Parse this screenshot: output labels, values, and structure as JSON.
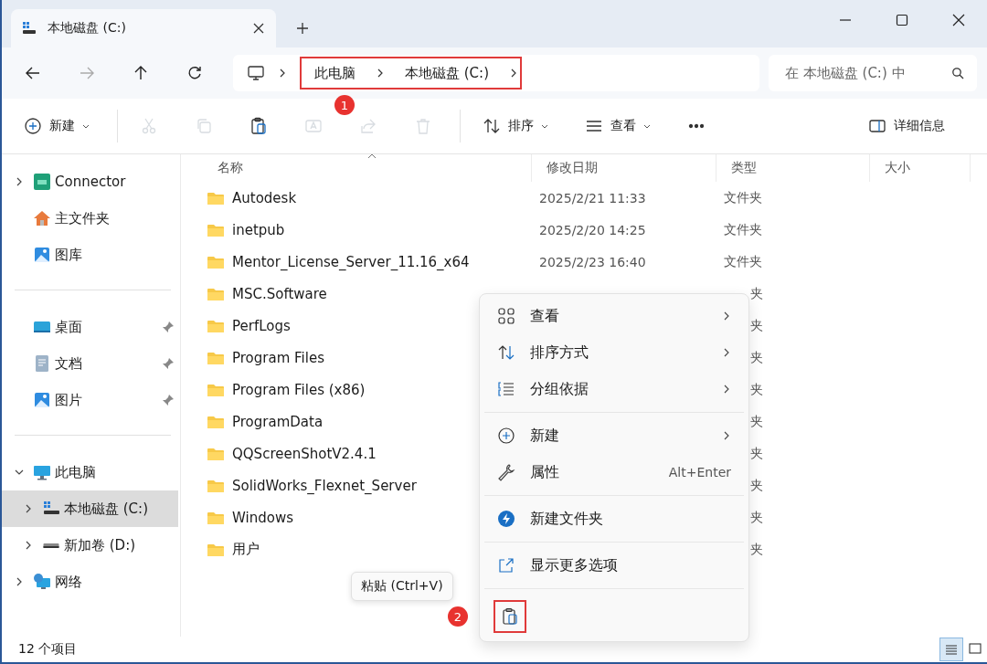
{
  "tab": {
    "title": "本地磁盘 (C:)"
  },
  "breadcrumb": [
    "此电脑",
    "本地磁盘 (C:)"
  ],
  "search": {
    "placeholder": "在 本地磁盘 (C:) 中"
  },
  "toolbar": [
    {
      "kind": "new",
      "label": "新建",
      "disabled": false
    },
    {
      "kind": "cut",
      "disabled": true
    },
    {
      "kind": "copy",
      "disabled": true
    },
    {
      "kind": "paste",
      "disabled": false
    },
    {
      "kind": "rename",
      "disabled": true
    },
    {
      "kind": "share",
      "disabled": true
    },
    {
      "kind": "delete",
      "disabled": true
    },
    {
      "kind": "sort",
      "label": "排序",
      "disabled": false
    },
    {
      "kind": "view",
      "label": "查看",
      "disabled": false
    },
    {
      "kind": "more",
      "disabled": false
    }
  ],
  "details_button": "详细信息",
  "sidebar": {
    "groups": [
      [
        {
          "kind": "connector",
          "label": "Connector",
          "expanded": false,
          "pinned": false,
          "selected": false
        },
        {
          "kind": "home",
          "label": "主文件夹",
          "pinned": false,
          "selected": false
        },
        {
          "kind": "gallery",
          "label": "图库",
          "pinned": false,
          "selected": false
        }
      ],
      [
        {
          "kind": "desktop",
          "label": "桌面",
          "pinned": true,
          "selected": false
        },
        {
          "kind": "documents",
          "label": "文档",
          "pinned": true,
          "selected": false
        },
        {
          "kind": "pictures",
          "label": "图片",
          "pinned": true,
          "selected": false
        }
      ],
      [
        {
          "kind": "pc",
          "label": "此电脑",
          "expanded": true,
          "pinned": false,
          "selected": false,
          "children": [
            {
              "kind": "drive-c",
              "label": "本地磁盘 (C:)",
              "expanded": false,
              "pinned": false,
              "selected": true
            },
            {
              "kind": "drive",
              "label": "新加卷 (D:)",
              "expanded": false,
              "pinned": false,
              "selected": false
            }
          ]
        },
        {
          "kind": "network",
          "label": "网络",
          "expanded": false,
          "pinned": false,
          "selected": false
        }
      ]
    ]
  },
  "table": {
    "columns": [
      "名称",
      "修改日期",
      "类型",
      "大小"
    ],
    "rows": [
      {
        "name": "Autodesk",
        "date": "2025/2/21 11:33",
        "type": "文件夹"
      },
      {
        "name": "inetpub",
        "date": "2025/2/20 14:25",
        "type": "文件夹"
      },
      {
        "name": "Mentor_License_Server_11.16_x64",
        "date": "2025/2/23 16:40",
        "type": "文件夹"
      },
      {
        "name": "MSC.Software",
        "type": "夹"
      },
      {
        "name": "PerfLogs",
        "type": "夹"
      },
      {
        "name": "Program Files",
        "type": "夹"
      },
      {
        "name": "Program Files (x86)",
        "type": "夹"
      },
      {
        "name": "ProgramData",
        "type": "夹"
      },
      {
        "name": "QQScreenShotV2.4.1",
        "type": "夹"
      },
      {
        "name": "SolidWorks_Flexnet_Server",
        "type": "夹"
      },
      {
        "name": "Windows",
        "type": "夹"
      },
      {
        "name": "用户",
        "type": "夹"
      }
    ]
  },
  "context_menu": {
    "groups": [
      [
        {
          "kind": "view",
          "label": "查看",
          "submenu": true
        },
        {
          "kind": "sort",
          "label": "排序方式",
          "submenu": true
        },
        {
          "kind": "group",
          "label": "分组依据",
          "submenu": true
        }
      ],
      [
        {
          "kind": "new",
          "label": "新建",
          "submenu": true
        },
        {
          "kind": "properties",
          "label": "属性",
          "shortcut": "Alt+Enter",
          "submenu": false
        }
      ],
      [
        {
          "kind": "new-folder",
          "label": "新建文件夹",
          "submenu": false
        }
      ],
      [
        {
          "kind": "more",
          "label": "显示更多选项",
          "submenu": false
        }
      ]
    ],
    "paste_tooltip": "粘贴 (Ctrl+V)"
  },
  "annotations": [
    "1",
    "2"
  ],
  "status_bar": {
    "count": "12 个项目",
    "views": [
      {
        "kind": "details",
        "selected": true
      },
      {
        "kind": "tiles",
        "selected": false
      }
    ]
  }
}
